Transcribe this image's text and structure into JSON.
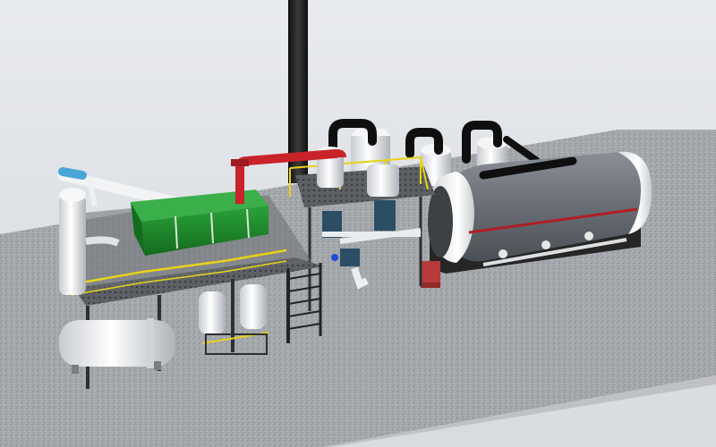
{
  "scene": {
    "subject": "pyrolysis-plant-3d-render",
    "colors": {
      "background": "#e6e8eb",
      "ground_speckle": "#9b9ea3",
      "reactor_body": "#6c7278",
      "reactor_end_cap": "#f2f2f2",
      "reactor_stripe": "#b01e24",
      "frame_base": "#2a2a2a",
      "chimney": "#1c1c1c",
      "pipe_red": "#c8232b",
      "tank_green": "#1c8a2a",
      "handrail_yellow": "#e8d21a",
      "structural_steel": "#3a3a3a",
      "condenser_white": "#eef0f2",
      "feed_auger_blue": "#4aa6d6",
      "accent_blue": "#1e4ed8",
      "pump_blue": "#2c4e64",
      "burner_red": "#b83a3a",
      "elbow_black": "#0f0f0f"
    }
  }
}
